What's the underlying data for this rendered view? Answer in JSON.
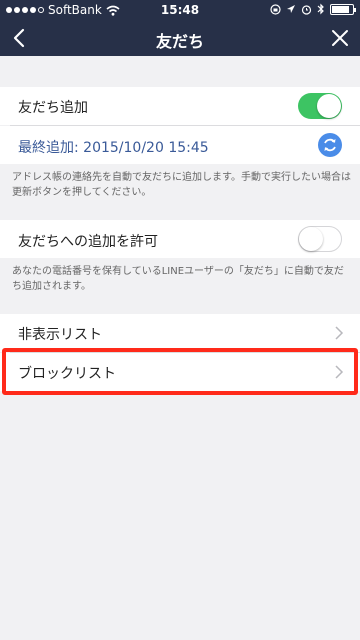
{
  "status_bar": {
    "carrier": "SoftBank",
    "time": "15:48",
    "signal_bars": 4
  },
  "nav": {
    "title": "友だち",
    "back_icon": "chevron-left-icon",
    "close_icon": "close-icon"
  },
  "settings": {
    "add_friends": {
      "label": "友だち追加",
      "enabled": true
    },
    "last_added": {
      "prefix": "最終追加:",
      "value": "2015/10/20 15:45",
      "refresh_icon": "refresh-icon"
    },
    "add_friends_note": "アドレス帳の連絡先を自動で友だちに追加します。手動で実行したい場合は更新ボタンを押してください。",
    "allow_others": {
      "label": "友だちへの追加を許可",
      "enabled": false
    },
    "allow_others_note": "あなたの電話番号を保有しているLINEユーザーの「友だち」に自動で友だち追加されます。",
    "hidden_list": {
      "label": "非表示リスト"
    },
    "block_list": {
      "label": "ブロックリスト"
    }
  },
  "colors": {
    "navbar": "#273048",
    "toggle_on": "#3dc463",
    "link_blue": "#3a5a98",
    "highlight": "#ff2a1a"
  }
}
